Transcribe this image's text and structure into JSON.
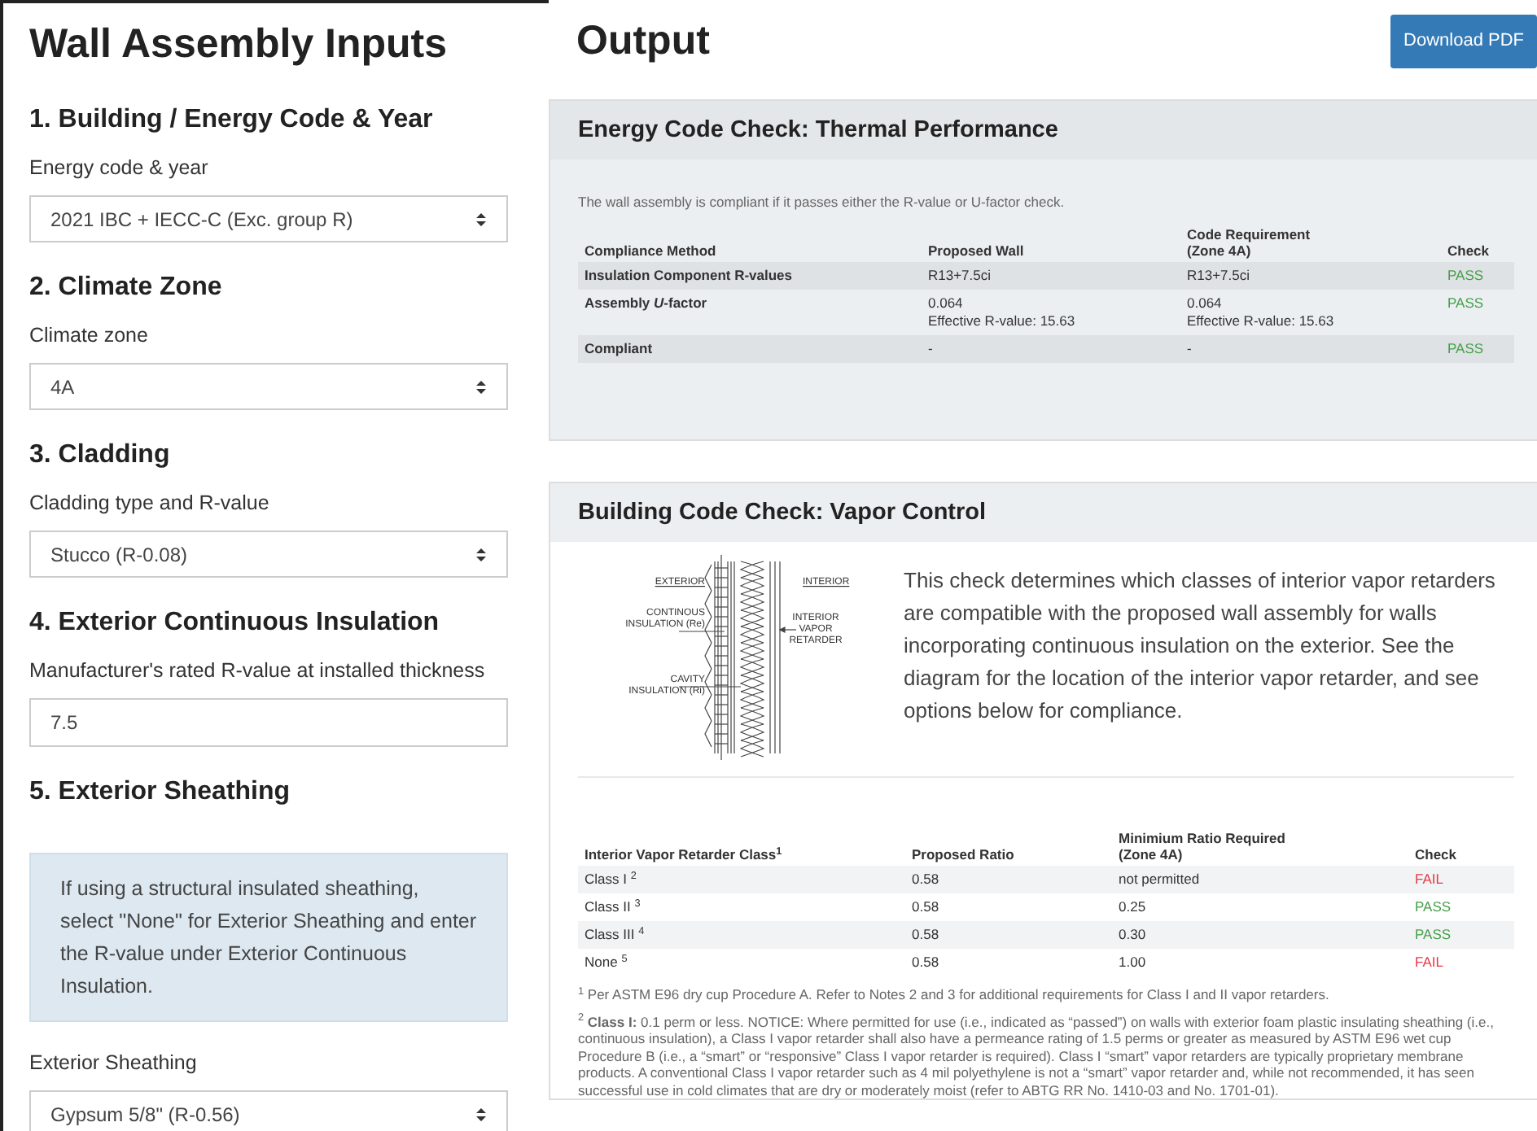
{
  "inputs": {
    "title": "Wall Assembly Inputs",
    "sections": [
      {
        "heading": "1. Building / Energy Code & Year",
        "parts": [
          {
            "kind": "label",
            "text": "Energy code & year"
          },
          {
            "kind": "select",
            "value": "2021 IBC + IECC-C (Exc. group R)"
          }
        ]
      },
      {
        "heading": "2. Climate Zone",
        "parts": [
          {
            "kind": "label",
            "text": "Climate zone"
          },
          {
            "kind": "select",
            "value": "4A"
          }
        ]
      },
      {
        "heading": "3. Cladding",
        "parts": [
          {
            "kind": "label",
            "text": "Cladding type and R-value"
          },
          {
            "kind": "select",
            "value": "Stucco (R-0.08)"
          }
        ]
      },
      {
        "heading": "4. Exterior Continuous Insulation",
        "parts": [
          {
            "kind": "label",
            "text": "Manufacturer's rated R-value at installed thickness"
          },
          {
            "kind": "input",
            "value": "7.5"
          }
        ]
      },
      {
        "heading": "5. Exterior Sheathing",
        "parts": [
          {
            "kind": "note",
            "text": "If using a structural insulated sheathing, select \"None\" for Exterior Sheathing and enter the R-value under Exterior Continuous Insulation."
          },
          {
            "kind": "label",
            "text": "Exterior Sheathing"
          },
          {
            "kind": "select",
            "value": "Gypsum 5/8\" (R-0.56)"
          }
        ]
      }
    ]
  },
  "output": {
    "title": "Output",
    "download_button": "Download PDF",
    "thermal": {
      "title": "Energy Code Check: Thermal Performance",
      "intro": "The wall assembly is compliant if it passes either the R-value or U-factor check.",
      "columns": [
        "Compliance Method",
        "Proposed Wall",
        "Code Requirement\n(Zone 4A)",
        "Check"
      ],
      "rows": [
        {
          "method": "Insulation Component R-values",
          "proposed": "R13+7.5ci",
          "required": "R13+7.5ci",
          "check": "PASS",
          "passed": true
        },
        {
          "method": "Assembly *U*-factor",
          "proposed": "0.064\nEffective R-value: 15.63",
          "required": "0.064\nEffective R-value: 15.63",
          "check": "PASS",
          "passed": true
        },
        {
          "method": "Compliant",
          "proposed": "-",
          "required": "-",
          "check": "PASS",
          "passed": true
        }
      ]
    },
    "vapor": {
      "title": "Building Code Check: Vapor Control",
      "diagram_labels": [
        "EXTERIOR",
        "CONTINOUS\nINSULATION (Re)",
        "CAVITY\nINSULATION (Ri)",
        "INTERIOR",
        "INTERIOR\nVAPOR\nRETARDER"
      ],
      "description": "This check determines which classes of interior vapor retarders are compatible with the proposed wall assembly for walls incorporating continuous insulation on the exterior. See the diagram for the location of the interior vapor retarder, and see options below for compliance.",
      "columns": [
        "Interior Vapor Retarder Class$^{1}$",
        "Proposed Ratio",
        "Minimium Ratio Required\n(Zone 4A)",
        "Check"
      ],
      "rows": [
        {
          "class": "Class I $^{2}$",
          "proposed": "0.58",
          "required": "not permitted",
          "check": "FAIL",
          "passed": false
        },
        {
          "class": "Class II $^{3}$",
          "proposed": "0.58",
          "required": "0.25",
          "check": "PASS",
          "passed": true
        },
        {
          "class": "Class III $^{4}$",
          "proposed": "0.58",
          "required": "0.30",
          "check": "PASS",
          "passed": true
        },
        {
          "class": "None $^{5}$",
          "proposed": "0.58",
          "required": "1.00",
          "check": "FAIL",
          "passed": false
        }
      ],
      "footnotes": [
        "$^{1}$ Per ASTM E96 dry cup Procedure A. Refer to Notes 2 and 3 for additional requirements for Class I and II vapor retarders.",
        "$^{2}$ **Class I:** 0.1 perm or less. NOTICE: Where permitted for use (i.e., indicated as “passed”) on walls with exterior foam plastic insulating sheathing (i.e., continuous insulation), a Class I vapor retarder shall also have a permeance rating of 1.5 perms or greater as measured by ASTM E96 wet cup Procedure B (i.e., a “smart” or “responsive” Class I vapor retarder is required). Class I “smart” vapor retarders are typically proprietary membrane products. A conventional Class I vapor retarder such as 4 mil polyethylene is not a “smart” vapor retarder and, while not recommended, it has seen successful use in cold climates that are dry or moderately moist (refer to ABTG RR No. 1410-03 and No. 1701-01)."
      ]
    }
  }
}
